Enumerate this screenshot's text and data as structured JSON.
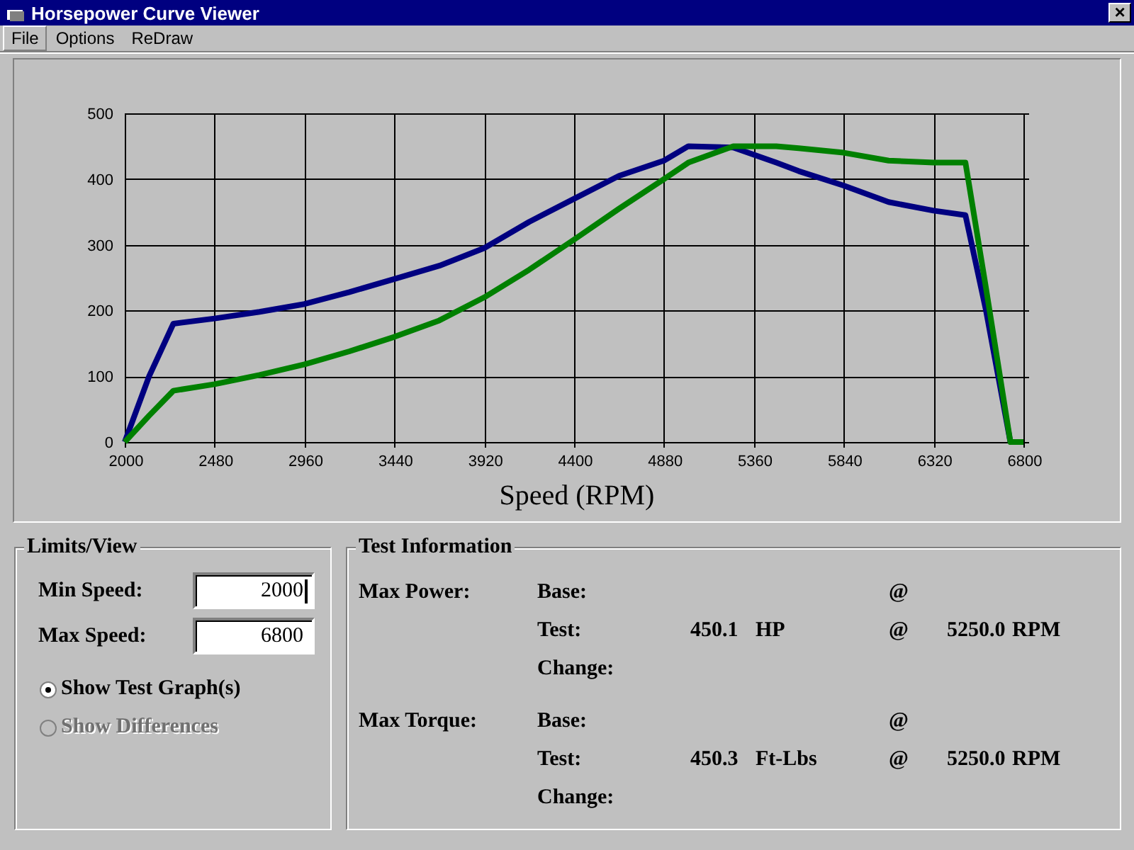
{
  "window": {
    "title": "Horsepower Curve Viewer",
    "close": "×"
  },
  "menu": [
    {
      "label": "File",
      "selected": true
    },
    {
      "label": "Options",
      "selected": false
    },
    {
      "label": "ReDraw",
      "selected": false
    }
  ],
  "graph": {
    "chart_data": {
      "type": "line",
      "grid": true,
      "xlabel": "Speed (RPM)",
      "xlim": [
        2000,
        6800
      ],
      "ylim": [
        0,
        500
      ],
      "xticks": [
        2000,
        2480,
        2960,
        3440,
        3920,
        4400,
        4880,
        5360,
        5840,
        6320,
        6800
      ],
      "yticks": [
        0,
        100,
        200,
        300,
        400,
        500
      ],
      "x": [
        2000,
        2130,
        2260,
        2480,
        2720,
        2960,
        3200,
        3440,
        3680,
        3920,
        4160,
        4400,
        4640,
        4880,
        5010,
        5250,
        5480,
        5600,
        5840,
        6080,
        6320,
        6490,
        6600,
        6730,
        6800
      ],
      "series": [
        {
          "color": "#000080",
          "values": [
            0,
            100,
            180,
            188,
            198,
            210,
            228,
            248,
            268,
            295,
            335,
            370,
            405,
            428,
            450,
            448,
            425,
            412,
            390,
            365,
            352,
            345,
            200,
            0,
            null
          ]
        },
        {
          "color": "#008000",
          "values": [
            0,
            40,
            78,
            88,
            102,
            118,
            138,
            160,
            185,
            220,
            262,
            308,
            355,
            400,
            425,
            450,
            450,
            447,
            440,
            428,
            425,
            425,
            234,
            0,
            0
          ]
        }
      ]
    }
  },
  "limits": {
    "title": "Limits/View",
    "fields": [
      {
        "label": "Min Speed:",
        "value": "2000",
        "focused": true
      },
      {
        "label": "Max Speed:",
        "value": "6800",
        "focused": false
      }
    ],
    "options": [
      {
        "label": "Show Test Graph(s)",
        "selected": true,
        "disabled": false
      },
      {
        "label": "Show Differences",
        "selected": false,
        "disabled": true
      }
    ]
  },
  "test_information": {
    "title": "Test Information",
    "groups": [
      {
        "label": "Max Power:",
        "rows": [
          {
            "label": "Base:",
            "at": "@"
          },
          {
            "label": "Test:",
            "value": "450.1",
            "unit": "HP",
            "at": "@",
            "speed": "5250.0",
            "speed_unit": "RPM"
          },
          {
            "label": "Change:"
          }
        ]
      },
      {
        "label": "Max Torque:",
        "rows": [
          {
            "label": "Base:",
            "at": "@"
          },
          {
            "label": "Test:",
            "value": "450.3",
            "unit": "Ft-Lbs",
            "at": "@",
            "speed": "5250.0",
            "speed_unit": "RPM"
          },
          {
            "label": "Change:"
          }
        ]
      }
    ]
  }
}
